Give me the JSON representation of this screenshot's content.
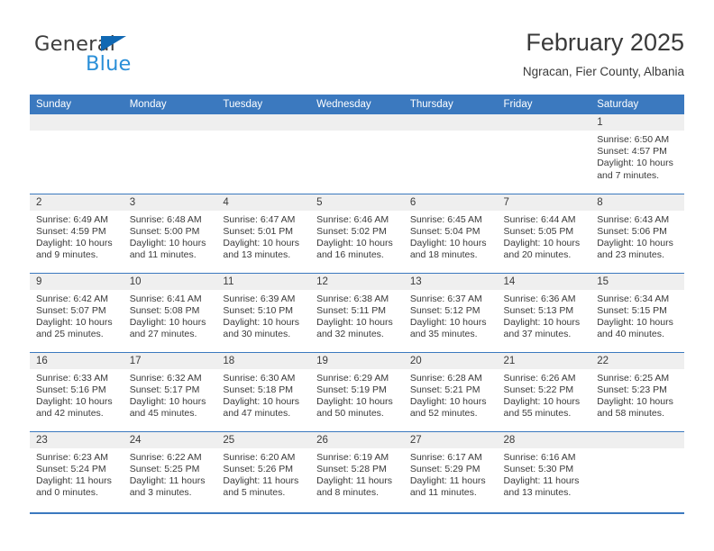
{
  "brand": {
    "name_part1": "General",
    "name_part2": "Blue"
  },
  "header": {
    "title": "February 2025",
    "subtitle": "Ngracan, Fier County, Albania"
  },
  "theme": {
    "header_blue": "#3b79bf",
    "logo_blue": "#2a8fd8",
    "logo_triangle_blue": "#1068b3",
    "day_band_gray": "#efefef",
    "text_gray": "#3a3a3a"
  },
  "weekdays": [
    "Sunday",
    "Monday",
    "Tuesday",
    "Wednesday",
    "Thursday",
    "Friday",
    "Saturday"
  ],
  "weeks": [
    [
      {
        "day": "",
        "sunrise": "",
        "sunset": "",
        "daylight_line1": "",
        "daylight_line2": ""
      },
      {
        "day": "",
        "sunrise": "",
        "sunset": "",
        "daylight_line1": "",
        "daylight_line2": ""
      },
      {
        "day": "",
        "sunrise": "",
        "sunset": "",
        "daylight_line1": "",
        "daylight_line2": ""
      },
      {
        "day": "",
        "sunrise": "",
        "sunset": "",
        "daylight_line1": "",
        "daylight_line2": ""
      },
      {
        "day": "",
        "sunrise": "",
        "sunset": "",
        "daylight_line1": "",
        "daylight_line2": ""
      },
      {
        "day": "",
        "sunrise": "",
        "sunset": "",
        "daylight_line1": "",
        "daylight_line2": ""
      },
      {
        "day": "1",
        "sunrise": "Sunrise: 6:50 AM",
        "sunset": "Sunset: 4:57 PM",
        "daylight_line1": "Daylight: 10 hours",
        "daylight_line2": "and 7 minutes."
      }
    ],
    [
      {
        "day": "2",
        "sunrise": "Sunrise: 6:49 AM",
        "sunset": "Sunset: 4:59 PM",
        "daylight_line1": "Daylight: 10 hours",
        "daylight_line2": "and 9 minutes."
      },
      {
        "day": "3",
        "sunrise": "Sunrise: 6:48 AM",
        "sunset": "Sunset: 5:00 PM",
        "daylight_line1": "Daylight: 10 hours",
        "daylight_line2": "and 11 minutes."
      },
      {
        "day": "4",
        "sunrise": "Sunrise: 6:47 AM",
        "sunset": "Sunset: 5:01 PM",
        "daylight_line1": "Daylight: 10 hours",
        "daylight_line2": "and 13 minutes."
      },
      {
        "day": "5",
        "sunrise": "Sunrise: 6:46 AM",
        "sunset": "Sunset: 5:02 PM",
        "daylight_line1": "Daylight: 10 hours",
        "daylight_line2": "and 16 minutes."
      },
      {
        "day": "6",
        "sunrise": "Sunrise: 6:45 AM",
        "sunset": "Sunset: 5:04 PM",
        "daylight_line1": "Daylight: 10 hours",
        "daylight_line2": "and 18 minutes."
      },
      {
        "day": "7",
        "sunrise": "Sunrise: 6:44 AM",
        "sunset": "Sunset: 5:05 PM",
        "daylight_line1": "Daylight: 10 hours",
        "daylight_line2": "and 20 minutes."
      },
      {
        "day": "8",
        "sunrise": "Sunrise: 6:43 AM",
        "sunset": "Sunset: 5:06 PM",
        "daylight_line1": "Daylight: 10 hours",
        "daylight_line2": "and 23 minutes."
      }
    ],
    [
      {
        "day": "9",
        "sunrise": "Sunrise: 6:42 AM",
        "sunset": "Sunset: 5:07 PM",
        "daylight_line1": "Daylight: 10 hours",
        "daylight_line2": "and 25 minutes."
      },
      {
        "day": "10",
        "sunrise": "Sunrise: 6:41 AM",
        "sunset": "Sunset: 5:08 PM",
        "daylight_line1": "Daylight: 10 hours",
        "daylight_line2": "and 27 minutes."
      },
      {
        "day": "11",
        "sunrise": "Sunrise: 6:39 AM",
        "sunset": "Sunset: 5:10 PM",
        "daylight_line1": "Daylight: 10 hours",
        "daylight_line2": "and 30 minutes."
      },
      {
        "day": "12",
        "sunrise": "Sunrise: 6:38 AM",
        "sunset": "Sunset: 5:11 PM",
        "daylight_line1": "Daylight: 10 hours",
        "daylight_line2": "and 32 minutes."
      },
      {
        "day": "13",
        "sunrise": "Sunrise: 6:37 AM",
        "sunset": "Sunset: 5:12 PM",
        "daylight_line1": "Daylight: 10 hours",
        "daylight_line2": "and 35 minutes."
      },
      {
        "day": "14",
        "sunrise": "Sunrise: 6:36 AM",
        "sunset": "Sunset: 5:13 PM",
        "daylight_line1": "Daylight: 10 hours",
        "daylight_line2": "and 37 minutes."
      },
      {
        "day": "15",
        "sunrise": "Sunrise: 6:34 AM",
        "sunset": "Sunset: 5:15 PM",
        "daylight_line1": "Daylight: 10 hours",
        "daylight_line2": "and 40 minutes."
      }
    ],
    [
      {
        "day": "16",
        "sunrise": "Sunrise: 6:33 AM",
        "sunset": "Sunset: 5:16 PM",
        "daylight_line1": "Daylight: 10 hours",
        "daylight_line2": "and 42 minutes."
      },
      {
        "day": "17",
        "sunrise": "Sunrise: 6:32 AM",
        "sunset": "Sunset: 5:17 PM",
        "daylight_line1": "Daylight: 10 hours",
        "daylight_line2": "and 45 minutes."
      },
      {
        "day": "18",
        "sunrise": "Sunrise: 6:30 AM",
        "sunset": "Sunset: 5:18 PM",
        "daylight_line1": "Daylight: 10 hours",
        "daylight_line2": "and 47 minutes."
      },
      {
        "day": "19",
        "sunrise": "Sunrise: 6:29 AM",
        "sunset": "Sunset: 5:19 PM",
        "daylight_line1": "Daylight: 10 hours",
        "daylight_line2": "and 50 minutes."
      },
      {
        "day": "20",
        "sunrise": "Sunrise: 6:28 AM",
        "sunset": "Sunset: 5:21 PM",
        "daylight_line1": "Daylight: 10 hours",
        "daylight_line2": "and 52 minutes."
      },
      {
        "day": "21",
        "sunrise": "Sunrise: 6:26 AM",
        "sunset": "Sunset: 5:22 PM",
        "daylight_line1": "Daylight: 10 hours",
        "daylight_line2": "and 55 minutes."
      },
      {
        "day": "22",
        "sunrise": "Sunrise: 6:25 AM",
        "sunset": "Sunset: 5:23 PM",
        "daylight_line1": "Daylight: 10 hours",
        "daylight_line2": "and 58 minutes."
      }
    ],
    [
      {
        "day": "23",
        "sunrise": "Sunrise: 6:23 AM",
        "sunset": "Sunset: 5:24 PM",
        "daylight_line1": "Daylight: 11 hours",
        "daylight_line2": "and 0 minutes."
      },
      {
        "day": "24",
        "sunrise": "Sunrise: 6:22 AM",
        "sunset": "Sunset: 5:25 PM",
        "daylight_line1": "Daylight: 11 hours",
        "daylight_line2": "and 3 minutes."
      },
      {
        "day": "25",
        "sunrise": "Sunrise: 6:20 AM",
        "sunset": "Sunset: 5:26 PM",
        "daylight_line1": "Daylight: 11 hours",
        "daylight_line2": "and 5 minutes."
      },
      {
        "day": "26",
        "sunrise": "Sunrise: 6:19 AM",
        "sunset": "Sunset: 5:28 PM",
        "daylight_line1": "Daylight: 11 hours",
        "daylight_line2": "and 8 minutes."
      },
      {
        "day": "27",
        "sunrise": "Sunrise: 6:17 AM",
        "sunset": "Sunset: 5:29 PM",
        "daylight_line1": "Daylight: 11 hours",
        "daylight_line2": "and 11 minutes."
      },
      {
        "day": "28",
        "sunrise": "Sunrise: 6:16 AM",
        "sunset": "Sunset: 5:30 PM",
        "daylight_line1": "Daylight: 11 hours",
        "daylight_line2": "and 13 minutes."
      },
      {
        "day": "",
        "sunrise": "",
        "sunset": "",
        "daylight_line1": "",
        "daylight_line2": ""
      }
    ]
  ]
}
